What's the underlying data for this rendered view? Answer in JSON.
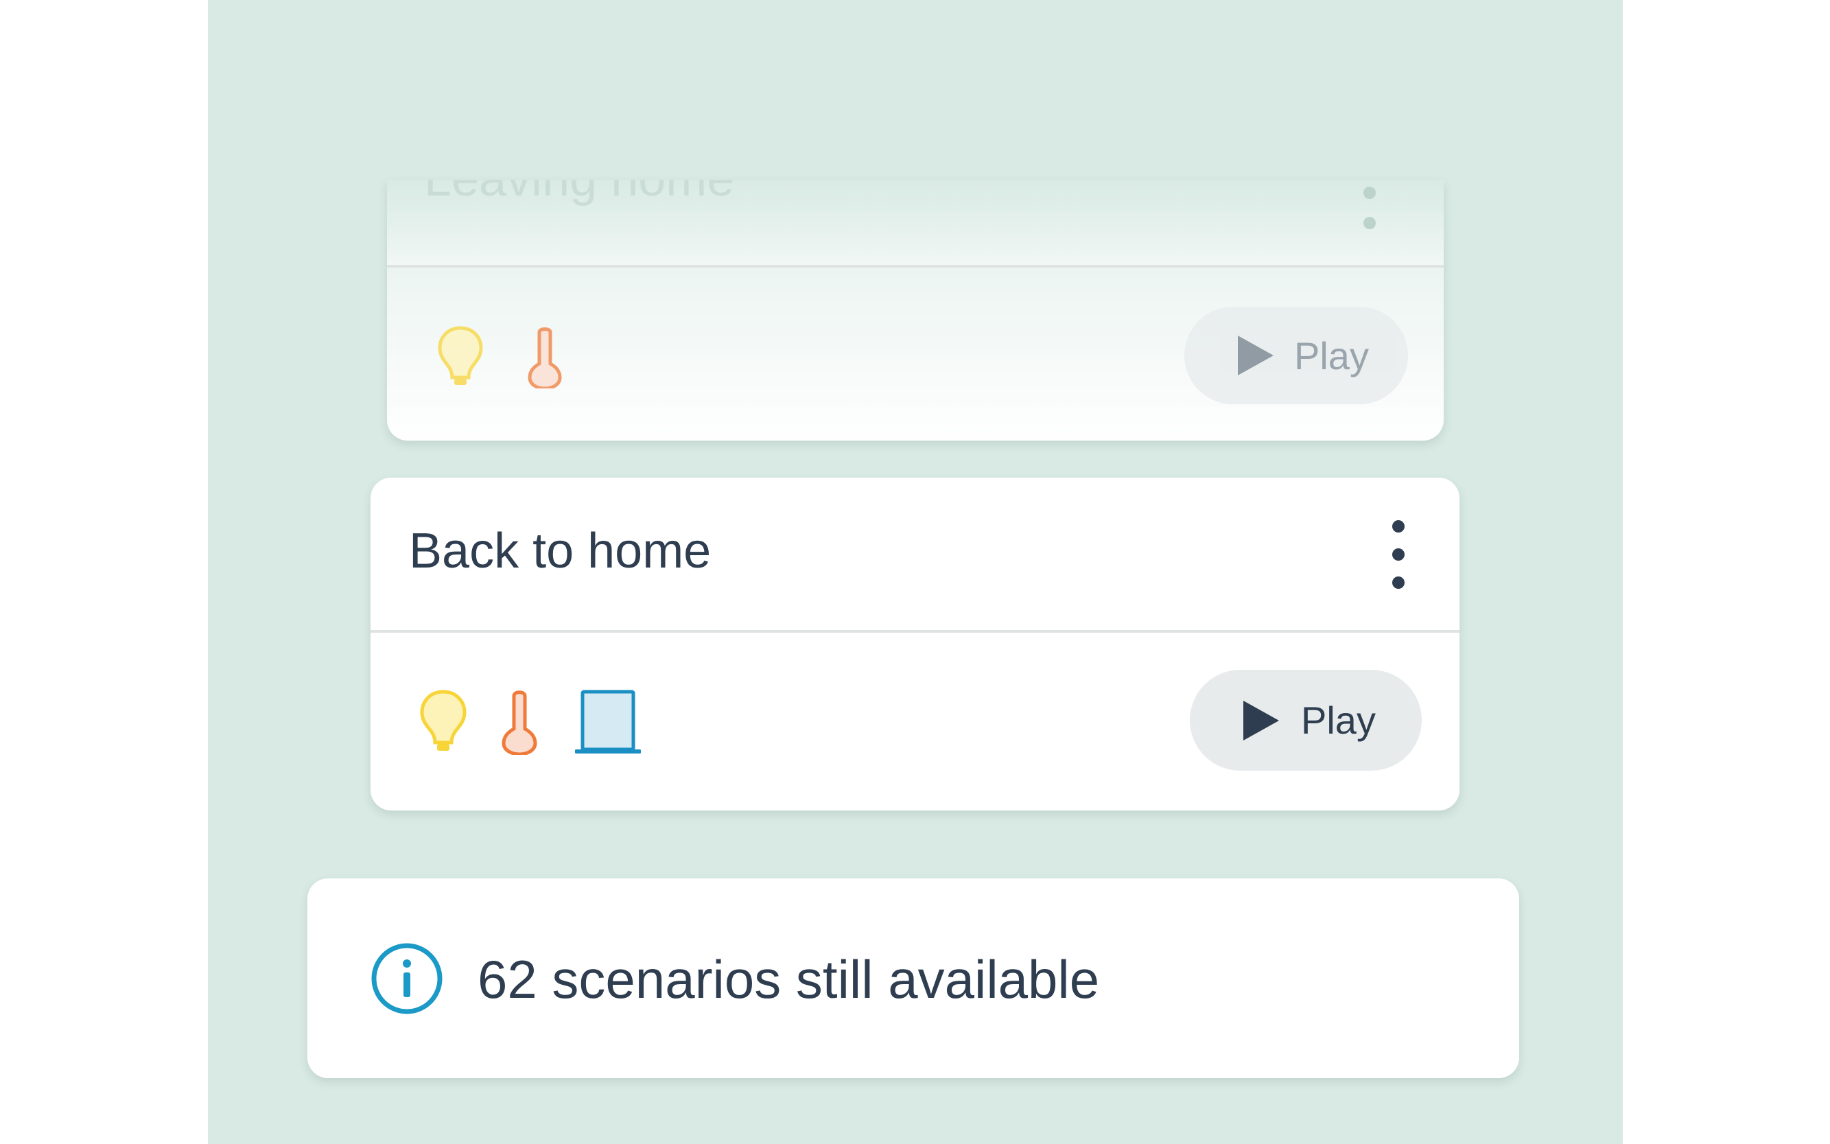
{
  "scenarios": [
    {
      "title": "Leaving home",
      "devices": [
        "lightbulb-icon",
        "thermometer-icon"
      ],
      "play_label": "Play"
    },
    {
      "title": "Back to home",
      "devices": [
        "lightbulb-icon",
        "thermometer-icon",
        "shutter-icon"
      ],
      "play_label": "Play"
    }
  ],
  "info": {
    "icon": "info-icon",
    "text": "62 scenarios still available"
  },
  "colors": {
    "background": "#d9eae4",
    "card": "#ffffff",
    "text": "#2e3d4f",
    "light": "#f7d437",
    "heating": "#ef7a3a",
    "shutter": "#1b8fc4",
    "info": "#1b99c7"
  }
}
